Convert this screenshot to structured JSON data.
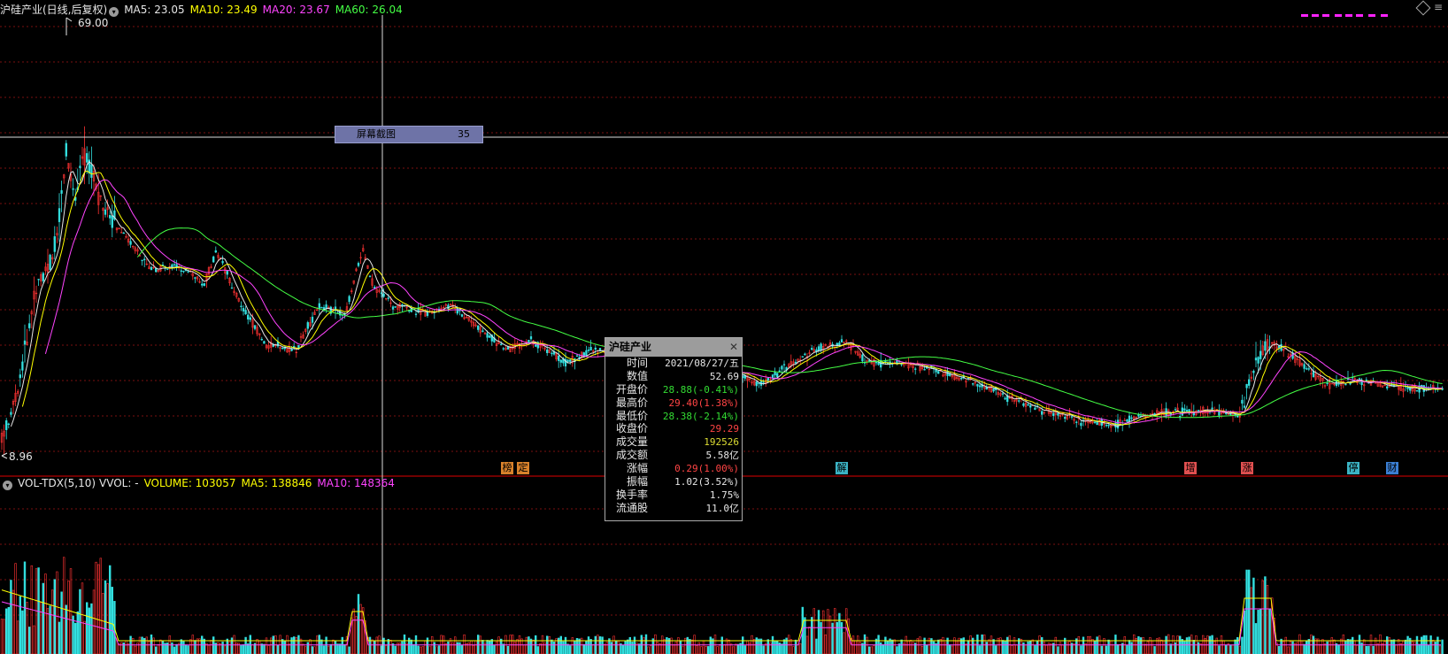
{
  "header": {
    "title": "沪硅产业(日线,后复权)",
    "ma5": "MA5: 23.05",
    "ma10": "MA10: 23.49",
    "ma20": "MA20: 23.67",
    "ma60": "MA60: 26.04",
    "colors": {
      "ma5": "#e6e6e6",
      "ma10": "#ffff00",
      "ma20": "#ff44ff",
      "ma60": "#44ff44"
    }
  },
  "price_labels": {
    "high": "69.00",
    "low": "8.96"
  },
  "crosshair_label": {
    "text": "屏幕截图",
    "value": "35"
  },
  "volume_header": {
    "name": "VOL-TDX(5,10)",
    "vvol": "VVOL: -",
    "volume": "VOLUME: 103057",
    "ma5": "MA5: 138846",
    "ma10": "MA10: 148364"
  },
  "tooltip": {
    "title": "沪硅产业",
    "close_icon": "close-icon",
    "rows": [
      {
        "k": "时间",
        "v": "2021/08/27/五",
        "color": "#e6e6e6"
      },
      {
        "k": "数值",
        "v": "52.69",
        "color": "#e6e6e6"
      },
      {
        "k": "开盘价",
        "v": "28.88(-0.41%)",
        "color": "#33dd33"
      },
      {
        "k": "最高价",
        "v": "29.40(1.38%)",
        "color": "#ff4444"
      },
      {
        "k": "最低价",
        "v": "28.38(-2.14%)",
        "color": "#33dd33"
      },
      {
        "k": "收盘价",
        "v": "29.29",
        "color": "#ff4444"
      },
      {
        "k": "成交量",
        "v": "192526",
        "color": "#dddd33"
      },
      {
        "k": "成交额",
        "v": "5.58亿",
        "color": "#e6e6e6"
      },
      {
        "k": "涨幅",
        "v": "0.29(1.00%)",
        "color": "#ff4444"
      },
      {
        "k": "振幅",
        "v": "1.02(3.52%)",
        "color": "#e6e6e6"
      },
      {
        "k": "换手率",
        "v": "1.75%",
        "color": "#e6e6e6"
      },
      {
        "k": "流通股",
        "v": "11.0亿",
        "color": "#e6e6e6"
      }
    ]
  },
  "event_badges": [
    {
      "text": "榜",
      "bg": "#d9822b"
    },
    {
      "text": "定",
      "bg": "#d9822b"
    },
    {
      "text": "解",
      "bg": "#3bb3c4"
    },
    {
      "text": "增",
      "bg": "#e05050"
    },
    {
      "text": "涨",
      "bg": "#e05050"
    },
    {
      "text": "停",
      "bg": "#3bb3c4"
    },
    {
      "text": "财",
      "bg": "#3b7fd4"
    }
  ],
  "chart_data": {
    "type": "candlestick",
    "price_extremes": {
      "high": 69.0,
      "low": 8.96
    },
    "ma_lines": [
      "MA5",
      "MA10",
      "MA20",
      "MA60"
    ],
    "price_ylim": [
      6,
      72
    ]
  }
}
